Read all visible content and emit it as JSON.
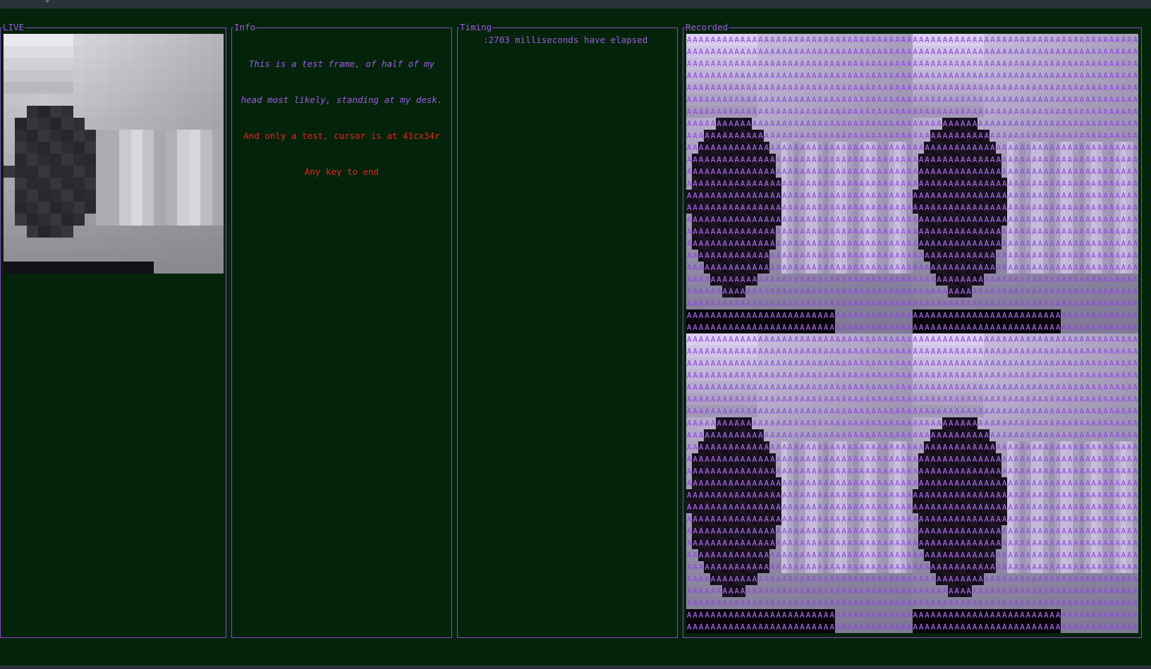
{
  "panes": {
    "live": {
      "title": "LIVE"
    },
    "info": {
      "title": "Info",
      "lines": [
        "This is a test frame, of half of my",
        "head most likely, standing at my desk.",
        "And only a test, cursor is at 41cx34r",
        "Any key to end"
      ]
    },
    "timing": {
      "title": "Timing",
      "elapsed_text": ":2703 milliseconds have elapsed"
    },
    "recorded": {
      "title": "Recorded",
      "fill_char": "A"
    }
  },
  "colors": {
    "background": "#03240a",
    "border": "#8a48c8",
    "accent_purple": "#9d5be0",
    "accent_red": "#e32424",
    "topbar": "#2c323a"
  },
  "icons": {
    "topbar_caret": "chevron-down-icon"
  }
}
